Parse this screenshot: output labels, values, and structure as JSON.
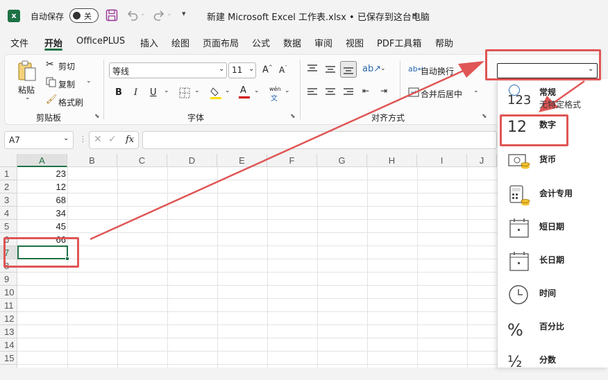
{
  "titlebar": {
    "autosave_label": "自动保存",
    "toggle_state": "关",
    "document_title": "新建 Microsoft Excel 工作表.xlsx • 已保存到这台电脑"
  },
  "menu": [
    "文件",
    "开始",
    "OfficePLUS",
    "插入",
    "绘图",
    "页面布局",
    "公式",
    "数据",
    "审阅",
    "视图",
    "PDF工具箱",
    "帮助"
  ],
  "ribbon": {
    "clipboard": {
      "paste": "粘贴",
      "cut": "剪切",
      "copy": "复制",
      "format_painter": "格式刷",
      "group": "剪贴板"
    },
    "font": {
      "name": "等线",
      "size": "11",
      "bold": "B",
      "italic": "I",
      "underline": "U",
      "pinyin": "wén",
      "group": "字体"
    },
    "alignment": {
      "wrap": "自动换行",
      "merge": "合并后居中",
      "group": "对齐方式"
    }
  },
  "formula_bar": {
    "name_box": "A7",
    "fx": "fx"
  },
  "sheet": {
    "columns": [
      "A",
      "B",
      "C",
      "D",
      "E",
      "F",
      "G",
      "H",
      "I",
      "J"
    ],
    "rows": [
      "1",
      "2",
      "3",
      "4",
      "5",
      "6",
      "7",
      "8",
      "9",
      "10",
      "11",
      "12",
      "13",
      "14",
      "15"
    ],
    "values": [
      "23",
      "12",
      "68",
      "34",
      "45",
      "66"
    ]
  },
  "number_formats": [
    {
      "label": "常规",
      "sub": "无特定格式",
      "icon": "123"
    },
    {
      "label": "数字",
      "icon": "12"
    },
    {
      "label": "货币",
      "icon": "currency-icon"
    },
    {
      "label": "会计专用",
      "icon": "accounting-icon"
    },
    {
      "label": "短日期",
      "icon": "calendar-icon"
    },
    {
      "label": "长日期",
      "icon": "calendar-icon"
    },
    {
      "label": "时间",
      "icon": "clock-icon"
    },
    {
      "label": "百分比",
      "icon": "%"
    },
    {
      "label": "分数",
      "icon": "½"
    }
  ],
  "colors": {
    "excel_green": "#1e7145",
    "annotation_red": "#e05555",
    "font_color": "#d00000",
    "highlight": "#ffe000"
  }
}
